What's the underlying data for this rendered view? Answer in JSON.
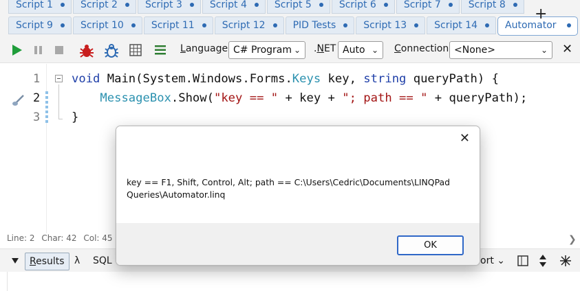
{
  "tabs_row1": [
    {
      "label": "Script 1"
    },
    {
      "label": "Script 2"
    },
    {
      "label": "Script 3"
    },
    {
      "label": "Script 4"
    },
    {
      "label": "Script 5"
    },
    {
      "label": "Script 6"
    },
    {
      "label": "Script 7"
    },
    {
      "label": "Script 8"
    }
  ],
  "tabs_row2": [
    {
      "label": "Script 9"
    },
    {
      "label": "Script 10"
    },
    {
      "label": "Script 11"
    },
    {
      "label": "Script 12"
    },
    {
      "label": "PID Tests"
    },
    {
      "label": "Script 13"
    },
    {
      "label": "Script 14"
    },
    {
      "label": "Automator"
    }
  ],
  "add_tab_label": "+",
  "toolbar": {
    "language_label_u": "L",
    "language_label_rest": "anguage",
    "language_value": "C# Program",
    "net_label_u": "N",
    "net_label_pre": ".",
    "net_label_rest": "ET",
    "net_value": "Auto",
    "connection_label_u": "C",
    "connection_label_rest": "onnection",
    "connection_value": "<None>",
    "close_label": "✕"
  },
  "editor": {
    "line_numbers": [
      "1",
      "2",
      "3"
    ],
    "line1": {
      "kw1": "void",
      "t1": " Main(System.Windows.Forms.",
      "ty1": "Keys",
      "t2": " key, ",
      "kw2": "string",
      "t3": " queryPath) {"
    },
    "line2": {
      "indent": "    ",
      "ty1": "MessageBox",
      "t1": ".Show(",
      "s1": "\"key == \"",
      "t2": " + key + ",
      "s2": "\"; path == \"",
      "t3": " + queryPath);"
    },
    "line3": {
      "t1": "}"
    }
  },
  "status": {
    "line": "Line: 2",
    "char": "Char: 42",
    "col": "Col: 45"
  },
  "results_bar": {
    "results_label_u": "R",
    "results_label_rest": "esults",
    "lambda_label": "λ",
    "sql_label": "SQL",
    "export_label": "ort",
    "chevron": "⌄"
  },
  "dialog": {
    "close_label": "✕",
    "message": "key == F1, Shift, Control, Alt; path == C:\\Users\\Cedric\\Documents\\LINQPad Queries\\Automator.linq",
    "ok_label": "OK"
  },
  "colors": {
    "tab_text": "#2d6ab3",
    "ok_border": "#2f67c7",
    "run_green": "#1f9d3a",
    "bug_red": "#c81e1e"
  }
}
